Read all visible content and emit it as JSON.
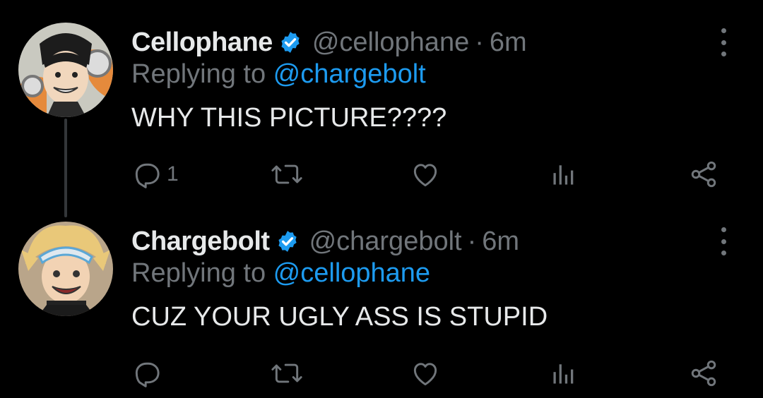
{
  "tweets": [
    {
      "display_name": "Cellophane",
      "handle": "@cellophane",
      "separator": "·",
      "time": "6m",
      "replying_prefix": "Replying to ",
      "replying_to": "@chargebolt",
      "text": "WHY THIS PICTURE????",
      "reply_count": "1",
      "avatar_icon": "anime-avatar-dark-hair",
      "verified_icon": "verified-badge-icon"
    },
    {
      "display_name": "Chargebolt",
      "handle": "@chargebolt",
      "separator": "·",
      "time": "6m",
      "replying_prefix": "Replying to ",
      "replying_to": "@cellophane",
      "text": "CUZ YOUR UGLY ASS IS STUPID",
      "reply_count": "",
      "avatar_icon": "anime-avatar-blonde-hair",
      "verified_icon": "verified-badge-icon"
    }
  ],
  "colors": {
    "background": "#000000",
    "text_primary": "#e7e9ea",
    "text_secondary": "#71767b",
    "accent": "#1d9bf0"
  },
  "action_icons": [
    "reply-icon",
    "retweet-icon",
    "like-icon",
    "views-icon",
    "share-icon"
  ]
}
